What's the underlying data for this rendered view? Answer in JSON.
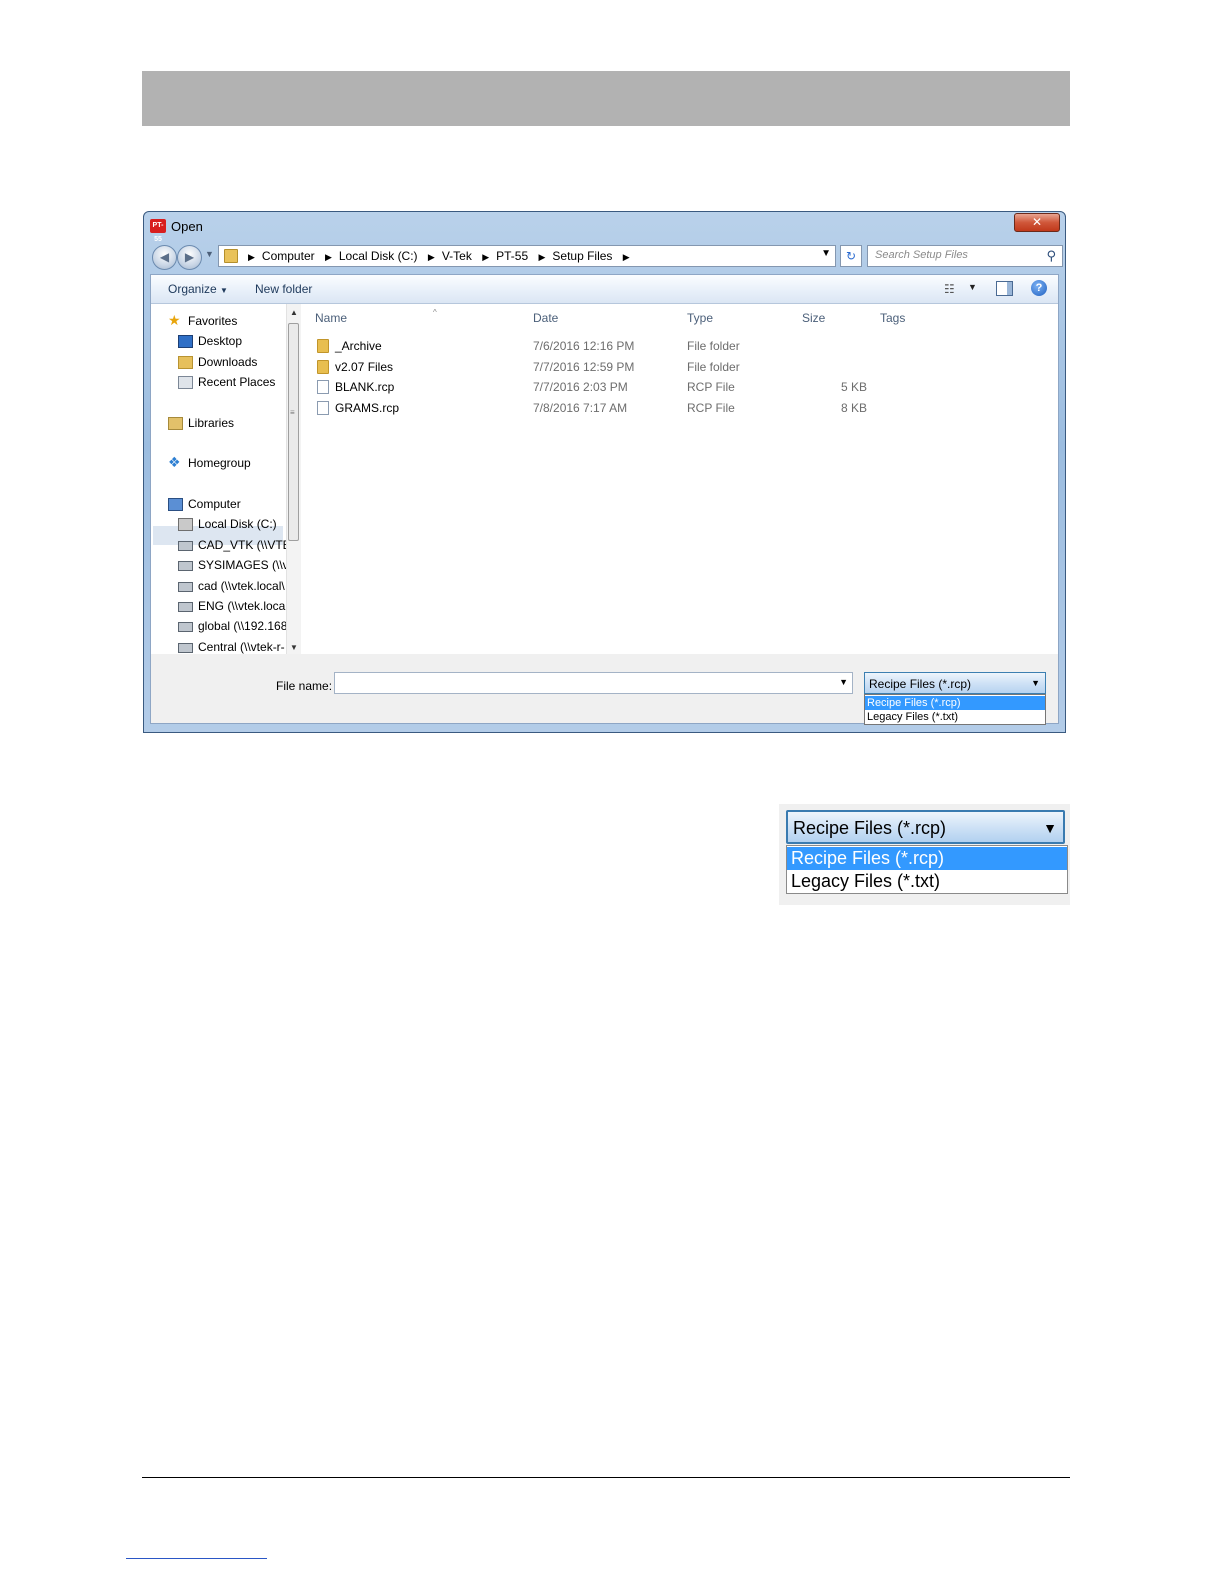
{
  "window": {
    "app_icon_text": "PT-55",
    "title": "Open",
    "close_symbol": "✕"
  },
  "address_bar": {
    "crumbs": [
      "Computer",
      "Local Disk (C:)",
      "V-Tek",
      "PT-55",
      "Setup Files"
    ],
    "search_placeholder": "Search Setup Files"
  },
  "toolbar": {
    "organize": "Organize",
    "new_folder": "New folder"
  },
  "nav_pane": {
    "items": [
      {
        "label": "Favorites",
        "icon": "star-icon"
      },
      {
        "label": "Desktop",
        "icon": "desktop-icon"
      },
      {
        "label": "Downloads",
        "icon": "downloads-icon"
      },
      {
        "label": "Recent Places",
        "icon": "recent-places-icon"
      },
      {
        "label": "Libraries",
        "icon": "libraries-icon"
      },
      {
        "label": "Homegroup",
        "icon": "homegroup-icon"
      },
      {
        "label": "Computer",
        "icon": "computer-icon"
      },
      {
        "label": "Local Disk (C:)",
        "icon": "disk-icon"
      },
      {
        "label": "CAD_VTK (\\\\VTEI",
        "icon": "network-drive-icon"
      },
      {
        "label": "SYSIMAGES (\\\\vt",
        "icon": "network-drive-icon"
      },
      {
        "label": "cad (\\\\vtek.local\\",
        "icon": "network-drive-icon"
      },
      {
        "label": "ENG (\\\\vtek.local",
        "icon": "network-drive-icon"
      },
      {
        "label": "global (\\\\192.168",
        "icon": "network-drive-icon"
      },
      {
        "label": "Central (\\\\vtek-r-",
        "icon": "network-drive-icon"
      }
    ],
    "selected": "Local Disk (C:)"
  },
  "file_list": {
    "columns": [
      "Name",
      "Date",
      "Type",
      "Size",
      "Tags"
    ],
    "rows": [
      {
        "name": "_Archive",
        "date": "7/6/2016 12:16 PM",
        "type": "File folder",
        "size": "",
        "kind": "folder"
      },
      {
        "name": "v2.07 Files",
        "date": "7/7/2016 12:59 PM",
        "type": "File folder",
        "size": "",
        "kind": "folder"
      },
      {
        "name": "BLANK.rcp",
        "date": "7/7/2016 2:03 PM",
        "type": "RCP File",
        "size": "5 KB",
        "kind": "file"
      },
      {
        "name": "GRAMS.rcp",
        "date": "7/8/2016 7:17 AM",
        "type": "RCP File",
        "size": "8 KB",
        "kind": "file"
      }
    ]
  },
  "file_name": {
    "label": "File name:",
    "value": ""
  },
  "file_type": {
    "selected": "Recipe Files (*.rcp)",
    "options": [
      "Recipe Files (*.rcp)",
      "Legacy Files (*.txt)"
    ]
  },
  "zoom_inset": {
    "selected": "Recipe Files (*.rcp)",
    "options": [
      "Recipe Files (*.rcp)",
      "Legacy Files (*.txt)"
    ]
  }
}
